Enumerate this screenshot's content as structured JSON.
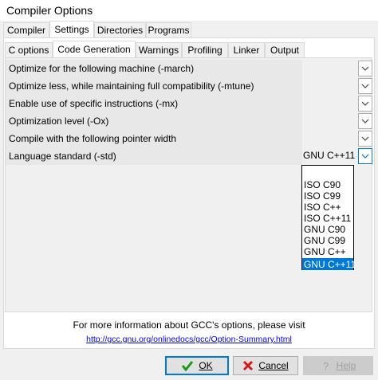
{
  "window": {
    "title": "Compiler Options"
  },
  "main_tabs": [
    {
      "label": "Compiler"
    },
    {
      "label": "Settings"
    },
    {
      "label": "Directories"
    },
    {
      "label": "Programs"
    }
  ],
  "sub_tabs": [
    {
      "label": "C options"
    },
    {
      "label": "Code Generation"
    },
    {
      "label": "Warnings"
    },
    {
      "label": "Profiling"
    },
    {
      "label": "Linker"
    },
    {
      "label": "Output"
    }
  ],
  "options": [
    {
      "label": "Optimize for the following machine (-march)",
      "value": ""
    },
    {
      "label": "Optimize less, while maintaining full compatibility (-mtune)",
      "value": ""
    },
    {
      "label": "Enable use of specific instructions (-mx)",
      "value": ""
    },
    {
      "label": "Optimization level (-Ox)",
      "value": ""
    },
    {
      "label": "Compile with the following pointer width",
      "value": ""
    },
    {
      "label": "Language standard (-std)",
      "value": "GNU C++11"
    }
  ],
  "dropdown": {
    "items": [
      "",
      "ISO C90",
      "ISO C99",
      "ISO C++",
      "ISO C++11",
      "GNU C90",
      "GNU C99",
      "GNU C++",
      "GNU C++11"
    ],
    "selected_index": 8
  },
  "info": {
    "text": "For more information about GCC's options, please visit",
    "link": "http://gcc.gnu.org/onlinedocs/gcc/Option-Summary.html"
  },
  "buttons": {
    "ok": "OK",
    "cancel": "Cancel",
    "help": "Help"
  },
  "colors": {
    "accent": "#0078d7",
    "ok_check": "#1a9a1a",
    "cancel_x": "#d11a1a"
  }
}
